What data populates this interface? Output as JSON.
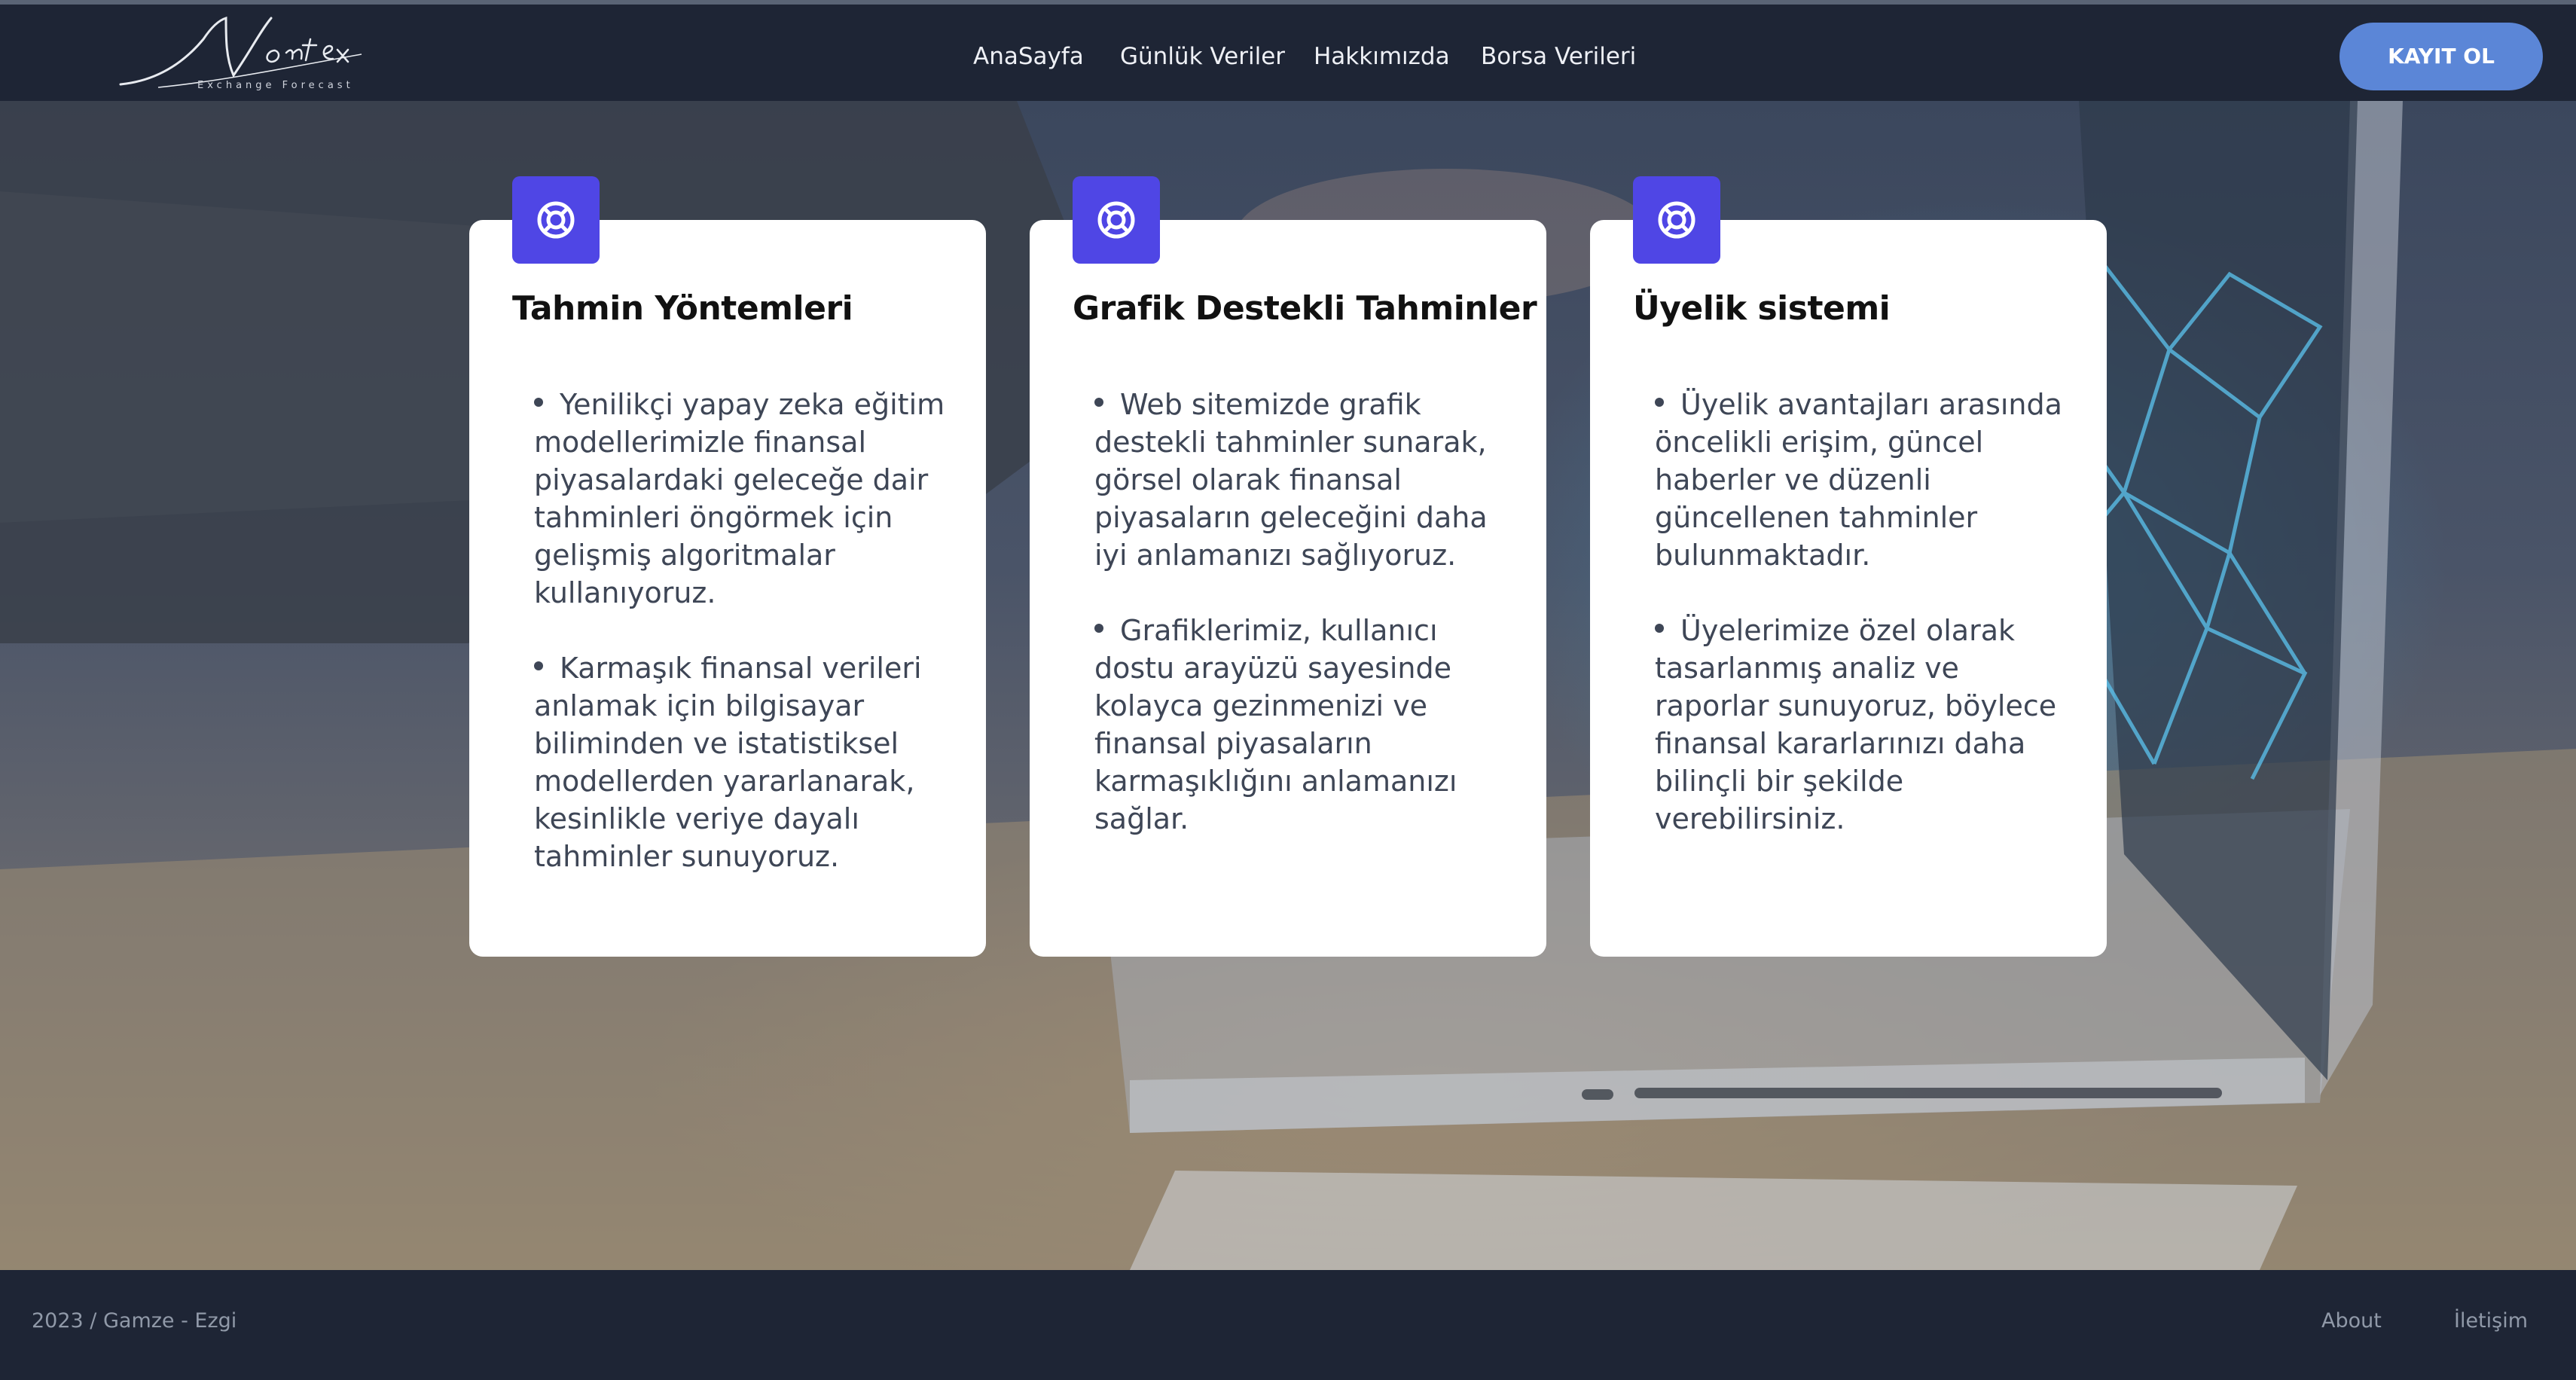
{
  "logo": {
    "script_text": "Vortex",
    "tagline": "Exchange Forecast"
  },
  "nav": {
    "items": [
      "AnaSayfa",
      "Günlük Veriler",
      "Hakkımızda",
      "Borsa Verileri"
    ],
    "cta_label": "KAYIT OL"
  },
  "colors": {
    "navbar_bg": "#1e2535",
    "accent_button": "#5b86d7",
    "icon_tile": "#4f46e5",
    "card_bg": "#ffffff"
  },
  "cards": [
    {
      "icon": "lifebuoy-icon",
      "title": "Tahmin Yöntemleri",
      "bullets": [
        "Yenilikçi yapay zeka eğitim modellerimizle finansal piyasalardaki geleceğe dair tahminleri öngörmek için gelişmiş algoritmalar kullanıyoruz.",
        "Karmaşık finansal verileri anlamak için bilgisayar biliminden ve istatistiksel modellerden yararlanarak, kesinlikle veriye dayalı tahminler sunuyoruz."
      ]
    },
    {
      "icon": "lifebuoy-icon",
      "title": "Grafik Destekli Tahminler",
      "bullets": [
        "Web sitemizde grafik destekli tahminler sunarak, görsel olarak finansal piyasaların geleceğini daha iyi anlamanızı sağlıyoruz.",
        "Grafiklerimiz, kullanıcı dostu arayüzü sayesinde kolayca gezinmenizi ve finansal piyasaların karmaşıklığını anlamanızı sağlar."
      ]
    },
    {
      "icon": "lifebuoy-icon",
      "title": "Üyelik sistemi",
      "bullets": [
        "Üyelik avantajları arasında öncelikli erişim, güncel haberler ve düzenli güncellenen tahminler bulunmaktadır.",
        "Üyelerimize özel olarak tasarlanmış analiz ve raporlar sunuyoruz, böylece finansal kararlarınızı daha bilinçli bir şekilde verebilirsiniz."
      ]
    }
  ],
  "footer": {
    "credit": "2023 / Gamze - Ezgi",
    "links": [
      "About",
      "İletişim"
    ]
  }
}
